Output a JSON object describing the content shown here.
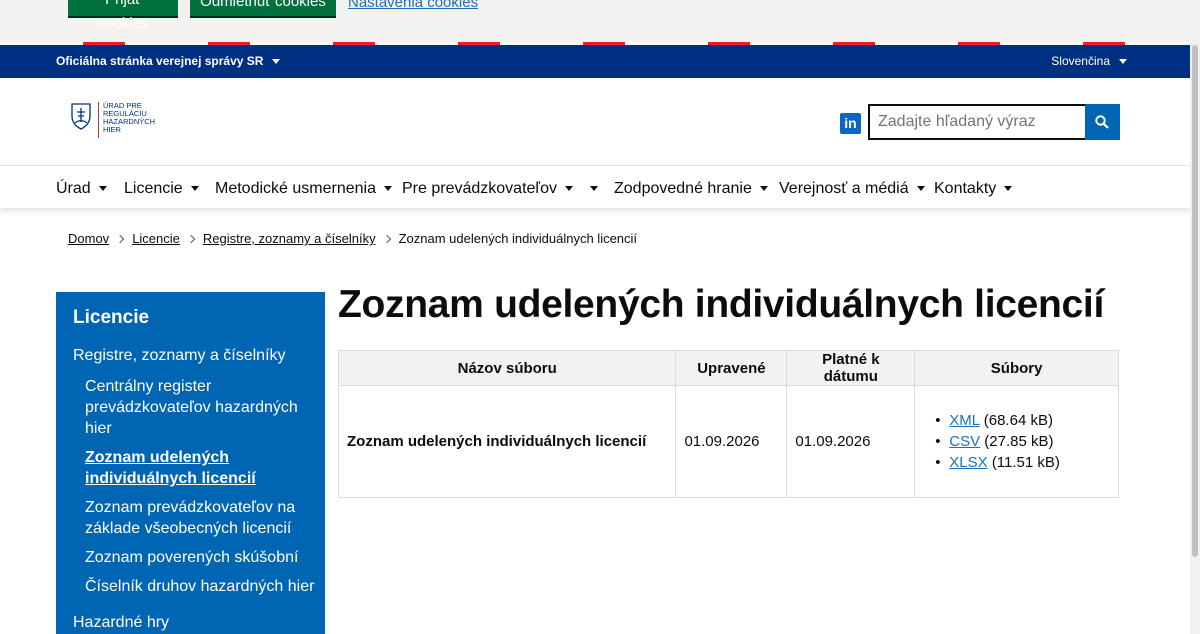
{
  "cookie_bar": {
    "accept_label": "Prijať cookies",
    "reject_label": "Odmietnuť cookies",
    "settings_label": "Nastavenia cookies"
  },
  "official": {
    "title": "Oficiálna stránka verejnej správy SR",
    "language": "Slovenčina"
  },
  "header": {
    "logo_text": "ÚRAD PRE REGULÁCIU HAZARDNÝCH HIER",
    "search_placeholder": "Zadajte hľadaný výraz"
  },
  "nav": {
    "items": [
      {
        "label": "Úrad"
      },
      {
        "label": "Licencie"
      },
      {
        "label": "Metodické usmernenia"
      },
      {
        "label": "Pre prevádzkovateľov"
      },
      {
        "label": ""
      },
      {
        "label": "Zodpovedné hranie"
      },
      {
        "label": "Verejnosť a médiá"
      },
      {
        "label": "Kontakty"
      }
    ]
  },
  "breadcrumb": {
    "items": [
      "Domov",
      "Licencie",
      "Registre, zoznamy a číselníky"
    ],
    "current": "Zoznam udelených individuálnych licencií"
  },
  "sidenav": {
    "title": "Licencie",
    "section": "Registre, zoznamy a číselníky",
    "subitems": [
      "Centrálny register prevádzkovateľov hazardných hier",
      "Zoznam udelených individuálnych licencií",
      "Zoznam prevádzkovateľov na základe všeobecných licencií",
      "Zoznam poverených skúšobní",
      "Číselník druhov hazardných hier"
    ],
    "bottom": "Hazardné hry"
  },
  "page": {
    "title": "Zoznam udelených individuálnych licencií"
  },
  "table": {
    "headers": [
      "Názov súboru",
      "Upravené",
      "Platné k dátumu",
      "Súbory"
    ],
    "row": {
      "name": "Zoznam udelených individuálnych licencií",
      "modified": "01.09.2026",
      "valid": "01.09.2026",
      "files": [
        {
          "format": "XML",
          "size": "(68.64 kB)"
        },
        {
          "format": "CSV",
          "size": "(27.85 kB)"
        },
        {
          "format": "XLSX",
          "size": "(11.51 kB)"
        }
      ]
    }
  },
  "colors": {
    "official_blue": "#003082",
    "nav_blue": "#0065b3",
    "cookie_green": "#00703c",
    "link_blue": "#1d70b8",
    "flag_red": "#ee1c25"
  }
}
